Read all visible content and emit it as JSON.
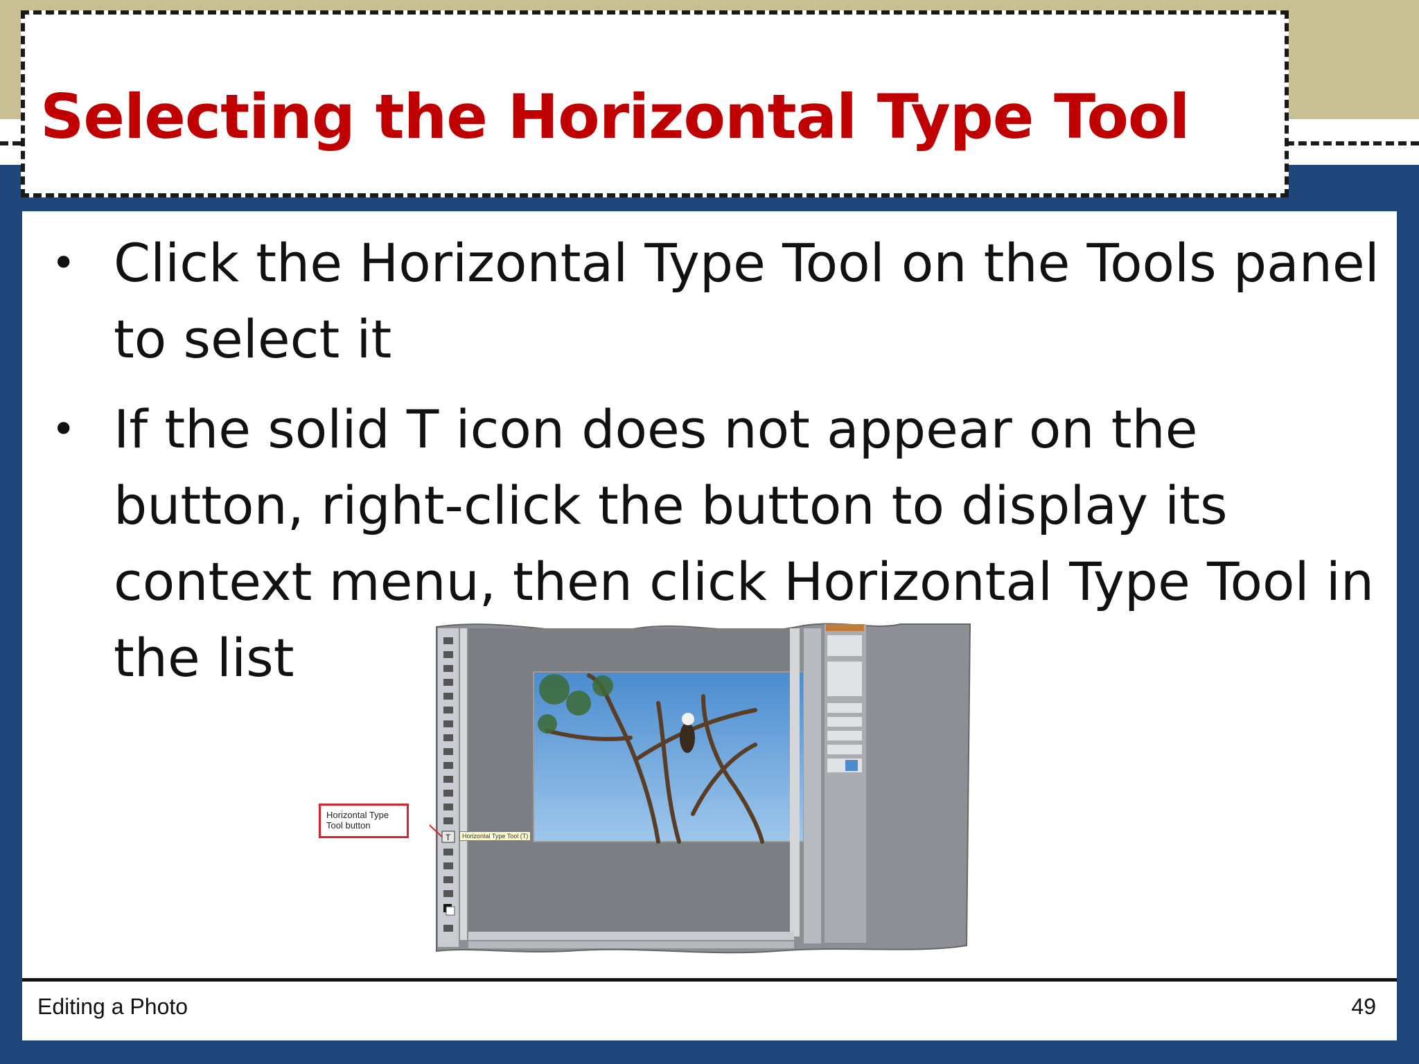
{
  "slide": {
    "title": "Selecting the Horizontal Type Tool",
    "bullets": [
      "Click the Horizontal Type Tool on the Tools panel to select it",
      "If the solid T icon does not appear on the button, right-click the button to display its context menu, then click Horizontal Type Tool in the list"
    ],
    "footer_left": "Editing a Photo",
    "page_number": "49"
  },
  "figure": {
    "callout_label": "Horizontal Type Tool button",
    "tooltip_label": "Horizontal Type Tool (T)"
  },
  "colors": {
    "title_red": "#c00000",
    "background_blue": "#1f477b",
    "band_tan": "#c8bf95",
    "callout_red": "#d9232a"
  }
}
